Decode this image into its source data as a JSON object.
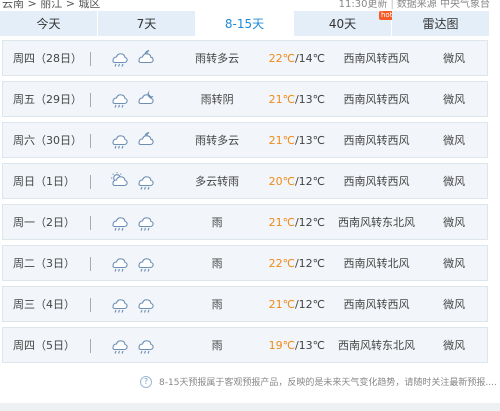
{
  "breadcrumb": "云南 > 丽江 > 城区",
  "source": {
    "updated": "11:30更新",
    "provider": "数据来源 中央气象台"
  },
  "tabs": [
    {
      "label": "今天",
      "active": false
    },
    {
      "label": "7天",
      "active": false
    },
    {
      "label": "8-15天",
      "active": true
    },
    {
      "label": "40天",
      "active": false,
      "badge": "hot"
    },
    {
      "label": "雷达图",
      "active": false
    }
  ],
  "colors": {
    "accent": "#1f8bd8",
    "high_temp": "#f08a18",
    "row_bg": "#f2f5f9",
    "tab_bg": "#e3eef8"
  },
  "days": [
    {
      "day": "周四（28日）",
      "icons": [
        "rain-cloud-icon",
        "cloudy-moon-icon"
      ],
      "condition": "雨转多云",
      "high": "22℃",
      "low": "/14℃",
      "wind": "西南风转西风",
      "level": "微风"
    },
    {
      "day": "周五（29日）",
      "icons": [
        "rain-cloud-icon",
        "cloud-moon-icon"
      ],
      "condition": "雨转阴",
      "high": "21℃",
      "low": "/13℃",
      "wind": "西南风转西风",
      "level": "微风"
    },
    {
      "day": "周六（30日）",
      "icons": [
        "rain-cloud-icon",
        "cloudy-moon-icon"
      ],
      "condition": "雨转多云",
      "high": "21℃",
      "low": "/13℃",
      "wind": "西南风转西风",
      "level": "微风"
    },
    {
      "day": "周日（1日）",
      "icons": [
        "partly-cloudy-sun-icon",
        "rain-cloud-icon"
      ],
      "condition": "多云转雨",
      "high": "20℃",
      "low": "/12℃",
      "wind": "西南风转西风",
      "level": "微风"
    },
    {
      "day": "周一（2日）",
      "icons": [
        "rain-cloud-icon",
        "rain-cloud-icon"
      ],
      "condition": "雨",
      "high": "21℃",
      "low": "/12℃",
      "wind": "西南风转东北风",
      "level": "微风"
    },
    {
      "day": "周二（3日）",
      "icons": [
        "rain-cloud-icon",
        "rain-cloud-icon"
      ],
      "condition": "雨",
      "high": "22℃",
      "low": "/12℃",
      "wind": "西南风转北风",
      "level": "微风"
    },
    {
      "day": "周三（4日）",
      "icons": [
        "rain-cloud-icon",
        "rain-cloud-icon"
      ],
      "condition": "雨",
      "high": "21℃",
      "low": "/12℃",
      "wind": "西南风转西风",
      "level": "微风"
    },
    {
      "day": "周四（5日）",
      "icons": [
        "rain-cloud-icon",
        "rain-cloud-icon"
      ],
      "condition": "雨",
      "high": "19℃",
      "low": "/13℃",
      "wind": "西南风转东北风",
      "level": "微风"
    }
  ],
  "note": "8-15天预报属于客观预报产品，反映的是未来天气变化趋势，请随时关注最新预报...."
}
